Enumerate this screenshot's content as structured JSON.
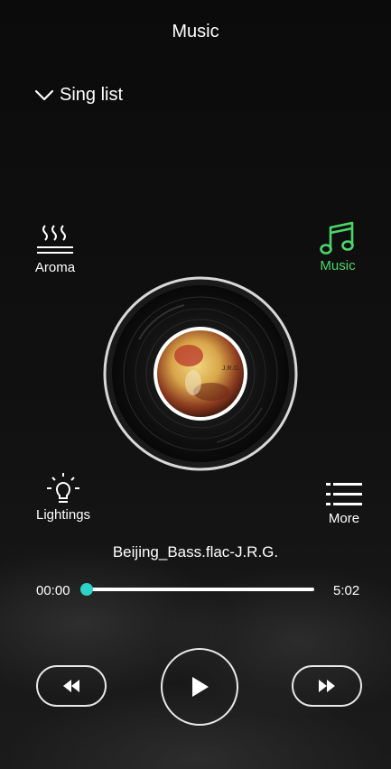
{
  "header": {
    "title": "Music"
  },
  "sing_list": {
    "label": "Sing list"
  },
  "side_buttons": {
    "aroma": "Aroma",
    "music": "Music",
    "lightings": "Lightings",
    "more": "More"
  },
  "player": {
    "track_title": "Beijing_Bass.flac-J.R.G.",
    "current_time": "00:00",
    "total_time": "5:02",
    "progress_fraction": 0,
    "album_label": "J.R.G."
  },
  "colors": {
    "accent_teal": "#2dd3c6",
    "active_green": "#4cd66a",
    "background": "#0a0a0a"
  },
  "icons": {
    "sing_list": "chevron-down-icon",
    "aroma": "steam-icon",
    "music": "music-note-icon",
    "lightings": "lightbulb-icon",
    "more": "list-icon",
    "prev": "rewind-icon",
    "play": "play-icon",
    "next": "fast-forward-icon"
  }
}
